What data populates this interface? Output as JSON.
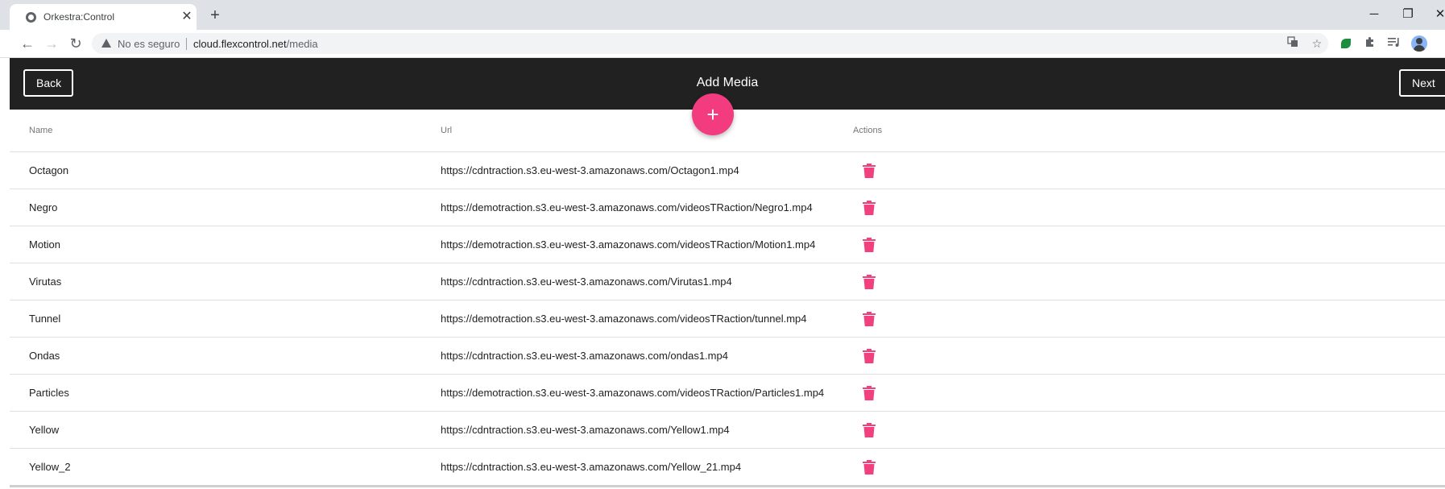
{
  "browser": {
    "tab_title": "Orkestra:Control",
    "tab_close": "✕",
    "new_tab": "+",
    "security_label": "No es seguro",
    "url_host": "cloud.flexcontrol.net",
    "url_path": "/media",
    "window_controls": {
      "minimize": "─",
      "restore": "❐",
      "close": "✕"
    },
    "nav": {
      "back": "←",
      "forward": "→",
      "reload": "↻"
    }
  },
  "header": {
    "title": "Add Media",
    "back_label": "Back",
    "next_label": "Next",
    "add_label": "+"
  },
  "table": {
    "columns": {
      "name": "Name",
      "url": "Url",
      "actions": "Actions"
    },
    "rows": [
      {
        "name": "Octagon",
        "url": "https://cdntraction.s3.eu-west-3.amazonaws.com/Octagon1.mp4"
      },
      {
        "name": "Negro",
        "url": "https://demotraction.s3.eu-west-3.amazonaws.com/videosTRaction/Negro1.mp4"
      },
      {
        "name": "Motion",
        "url": "https://demotraction.s3.eu-west-3.amazonaws.com/videosTRaction/Motion1.mp4"
      },
      {
        "name": "Virutas",
        "url": "https://cdntraction.s3.eu-west-3.amazonaws.com/Virutas1.mp4"
      },
      {
        "name": "Tunnel",
        "url": "https://demotraction.s3.eu-west-3.amazonaws.com/videosTRaction/tunnel.mp4"
      },
      {
        "name": "Ondas",
        "url": "https://cdntraction.s3.eu-west-3.amazonaws.com/ondas1.mp4"
      },
      {
        "name": "Particles",
        "url": "https://demotraction.s3.eu-west-3.amazonaws.com/videosTRaction/Particles1.mp4"
      },
      {
        "name": "Yellow",
        "url": "https://cdntraction.s3.eu-west-3.amazonaws.com/Yellow1.mp4"
      },
      {
        "name": "Yellow_2",
        "url": "https://cdntraction.s3.eu-west-3.amazonaws.com/Yellow_21.mp4"
      }
    ]
  },
  "colors": {
    "header_bg": "#212121",
    "accent_pink": "#f23c7f",
    "trash_pink": "#f2407f"
  }
}
